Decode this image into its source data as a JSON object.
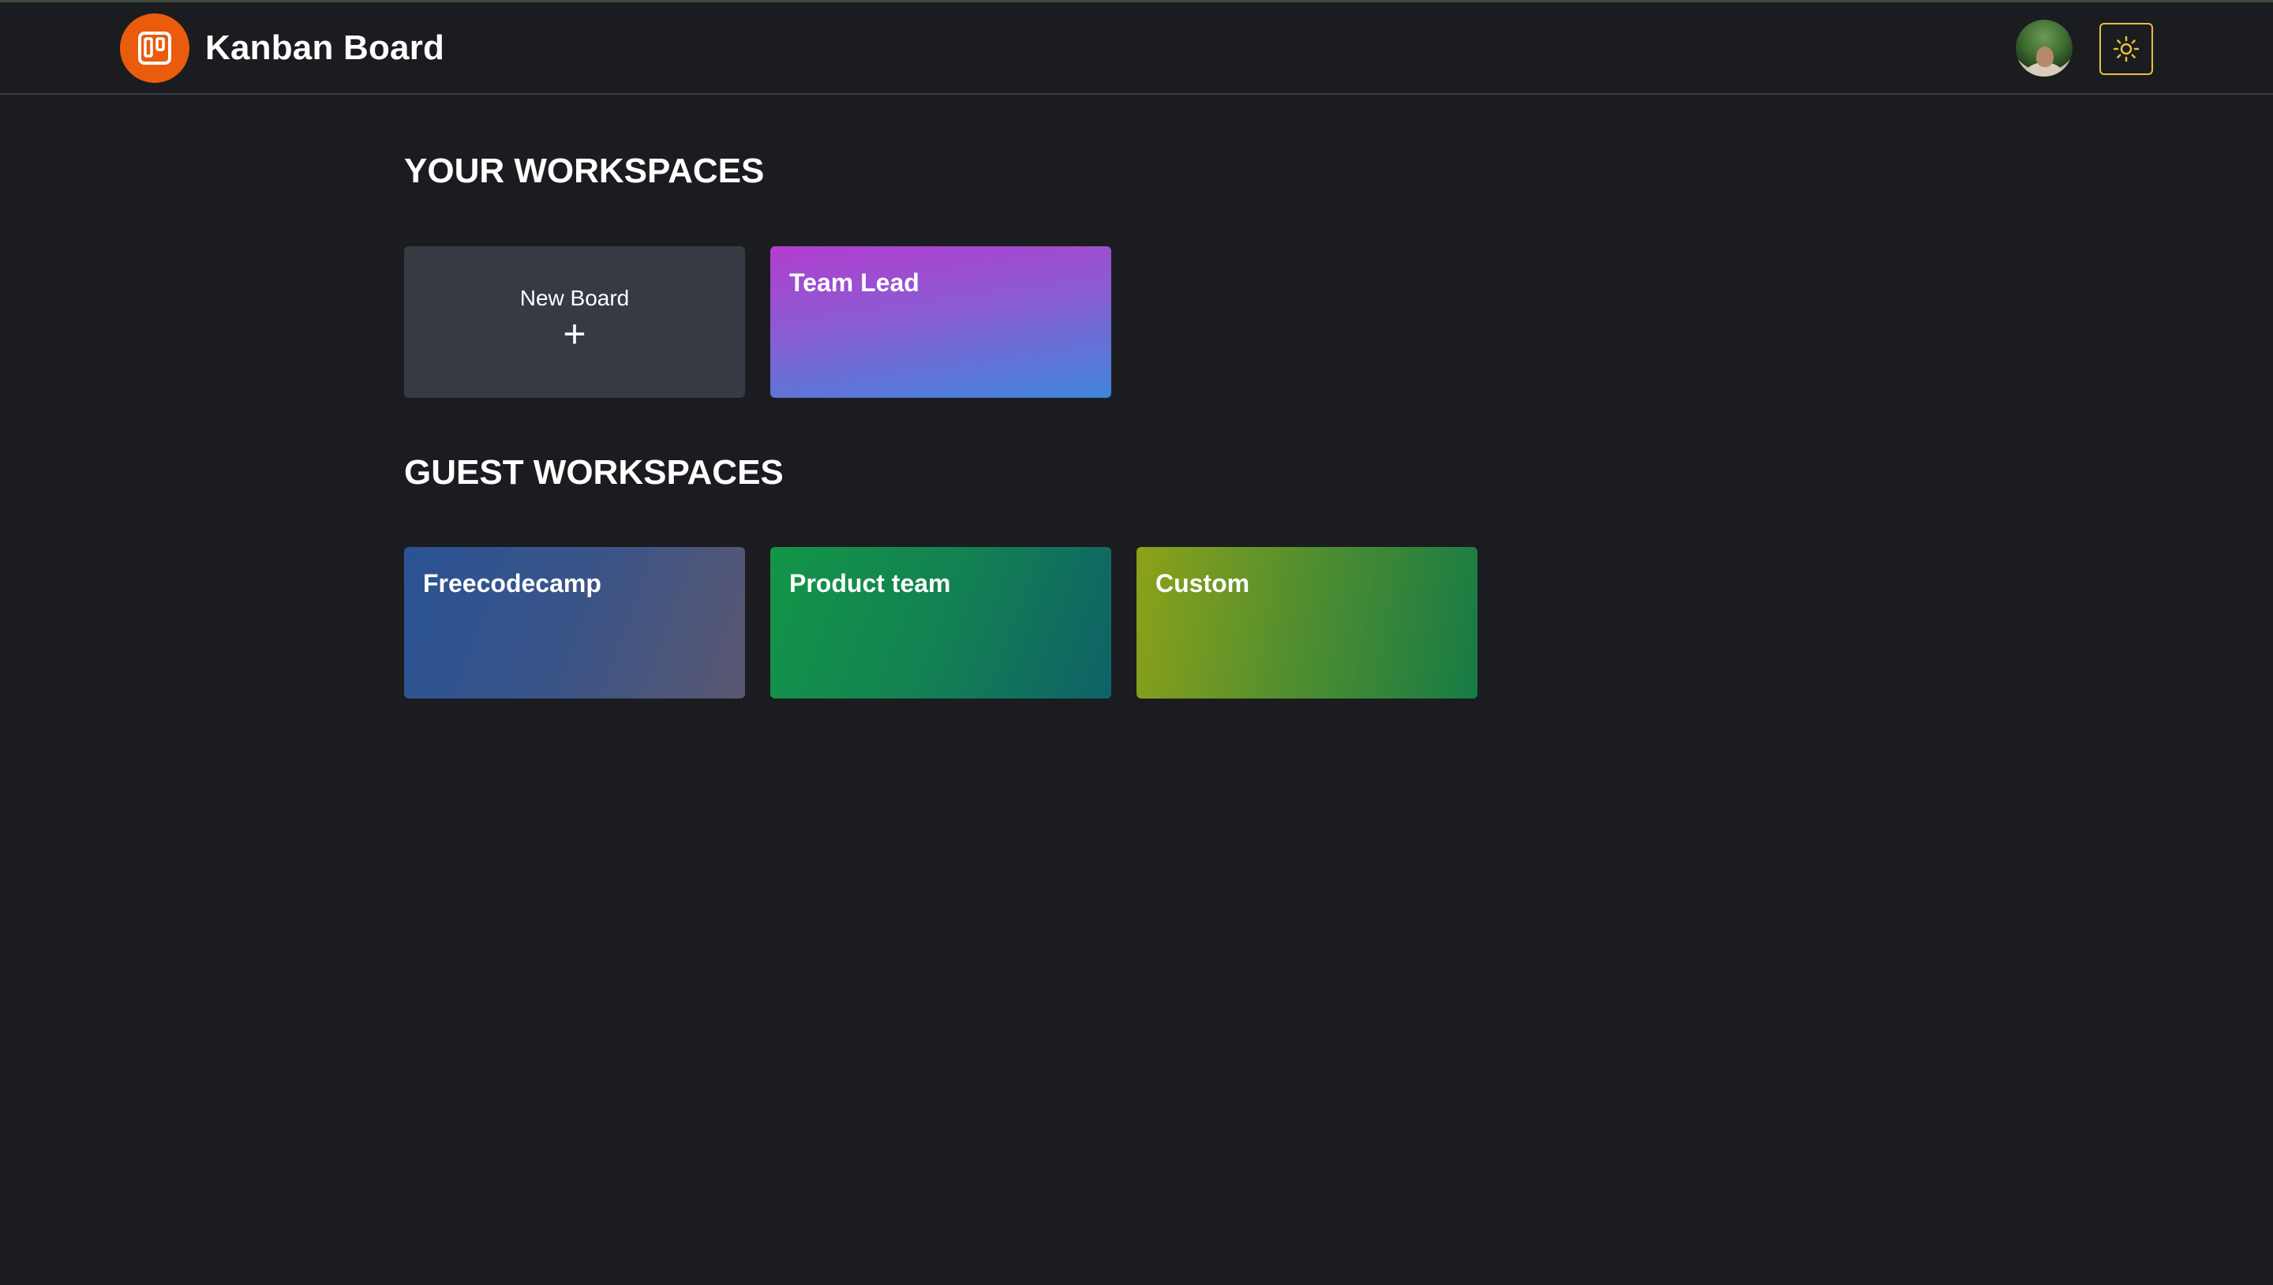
{
  "header": {
    "app_title": "Kanban Board",
    "logo_icon": "kanban-board-icon",
    "avatar_icon": "user-avatar",
    "theme_toggle_icon": "sun-icon",
    "colors": {
      "logo_bg": "#ea5b0c",
      "theme_toggle_border": "#e3c23a",
      "background": "#1b1c20"
    }
  },
  "your_workspaces": {
    "title": "YOUR WORKSPACES",
    "new_board": {
      "label": "New Board",
      "icon": "+"
    },
    "boards": [
      {
        "name": "Team Lead",
        "gradient": [
          "#b23ed0",
          "#3f85da"
        ]
      }
    ]
  },
  "guest_workspaces": {
    "title": "GUEST WORKSPACES",
    "boards": [
      {
        "name": "Freecodecamp",
        "gradient": [
          "#2a5394",
          "#5a5770"
        ]
      },
      {
        "name": "Product team",
        "gradient": [
          "#139647",
          "#0f6167"
        ]
      },
      {
        "name": "Custom",
        "gradient": [
          "#8da219",
          "#167b45"
        ]
      }
    ]
  }
}
